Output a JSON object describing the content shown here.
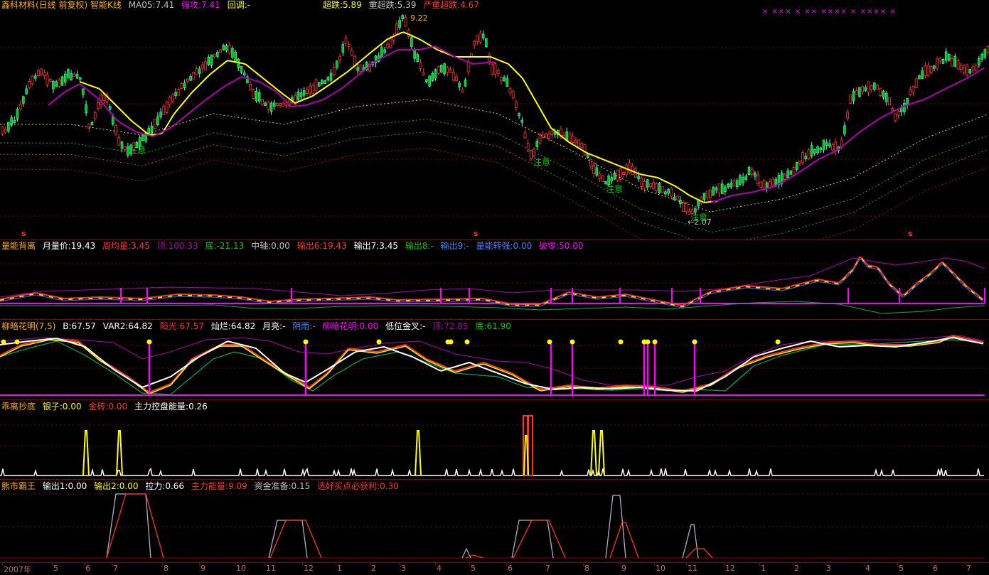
{
  "main": {
    "legend": {
      "title": "鑫科材料(日线 前复权) 智能K线",
      "ma5": "MA05:7.41",
      "strong": "强攻:7.41",
      "pullback": "回调:-",
      "oversold": "超跌:5.89",
      "heavy": "重超跌:5.39",
      "severe": "严重超跌:4.67"
    },
    "annotations": {
      "high": "9.22",
      "low": "←2.07",
      "notes": [
        "注意",
        "注意",
        "注意",
        "注意"
      ],
      "s_marks": [
        "s",
        "s",
        "s"
      ],
      "x_marks": "× ××× × ×× ×××× × ×××× ×"
    }
  },
  "panel2": {
    "legend": {
      "name": "量能背离",
      "a": "月量价:19.43",
      "b": "周均量:3.45",
      "c": "顶:100.33",
      "d": "底:-21.13",
      "e": "中轴:0.00",
      "f": "输出6:19.43",
      "g": "输出7:3.45",
      "h": "输出8:-",
      "i": "输出9:-",
      "j": "量能转强:0.00",
      "k": "破零:50.00"
    }
  },
  "panel3": {
    "legend": {
      "name": "柳暗花明(7,5)",
      "a": "B:67.57",
      "b": "VAR2:64.82",
      "c": "阳光:67.57",
      "d": "灿烂:64.82",
      "e": "月亮:-",
      "f": "阴雨:-",
      "g": "柳暗花明:0.00",
      "h": "低位金叉:-",
      "i": "顶:72.85",
      "j": "底:61.90"
    }
  },
  "panel4": {
    "legend": {
      "name": "乖离抄底",
      "a": "银子:0.00",
      "b": "金砖:0.00",
      "c": "主力控盘能量:0.26"
    }
  },
  "panel5": {
    "legend": {
      "name": "熊市霸王",
      "a": "输出1:0.00",
      "b": "输出2:0.00",
      "c": "拉力:0.66",
      "d": "主力能量:9.09",
      "e": "资金准备:0.15",
      "f": "选好买点必获利:0.30"
    }
  },
  "x_axis": {
    "labels": [
      "2007年",
      "5",
      "6",
      "7",
      "8",
      "9",
      "10",
      "11",
      "12",
      "1",
      "2",
      "3",
      "4",
      "5",
      "6",
      "7",
      "8",
      "9",
      "10",
      "11",
      "12",
      "1",
      "2",
      "3",
      "4",
      "5",
      "6",
      "7"
    ]
  },
  "colors": {
    "up": "#ff3232",
    "down": "#54fcfc",
    "down_fill": "#00cc00",
    "yellow": "#ffff00",
    "magenta": "#ff00ff",
    "purple": "#b000b0",
    "green": "#00b050",
    "white": "#ffffff",
    "grid": "#8b0000"
  },
  "chart_data": {
    "type": "line",
    "title": "鑫科材料(日线 前复权) 智能K线",
    "x": [
      "2007年",
      "5",
      "6",
      "7",
      "8",
      "9",
      "10",
      "11",
      "12",
      "1",
      "2",
      "3",
      "4",
      "5",
      "6",
      "7",
      "8",
      "9",
      "10",
      "11",
      "12",
      "1",
      "2",
      "3",
      "4",
      "5",
      "6",
      "7"
    ],
    "series": [
      {
        "name": "price",
        "values": [
          6.0,
          7.0,
          7.6,
          6.2,
          5.8,
          7.7,
          7.3,
          6.2,
          6.8,
          7.2,
          8.3,
          8.5,
          9.22,
          8.3,
          8.0,
          7.2,
          5.2,
          4.8,
          4.0,
          3.2,
          2.3,
          2.07,
          2.7,
          3.3,
          3.8,
          5.5,
          5.7,
          7.4
        ]
      }
    ]
  }
}
